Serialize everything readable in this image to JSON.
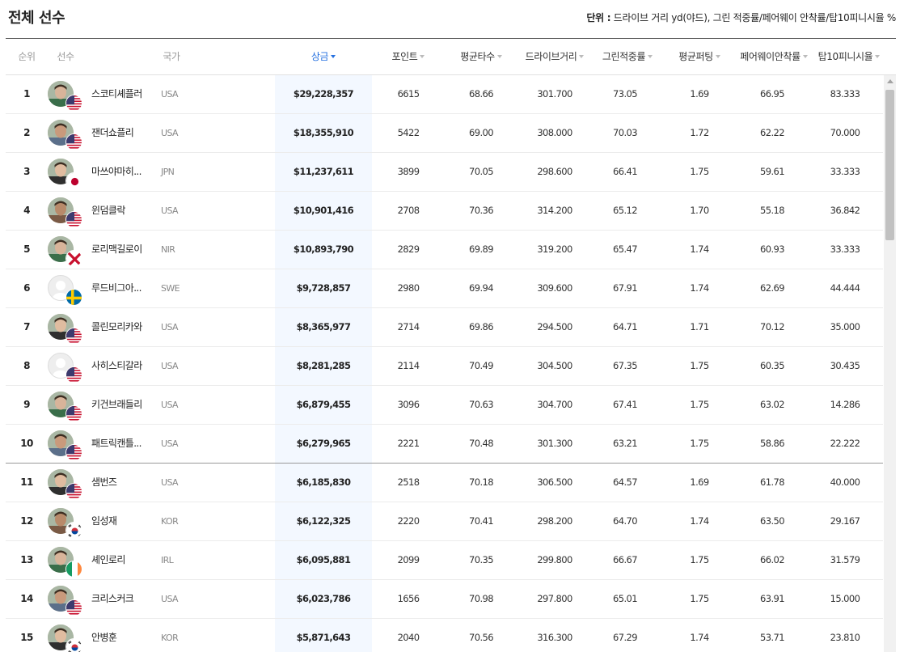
{
  "page": {
    "title": "전체 선수",
    "unit_label": "단위 :",
    "unit_text": "드라이브 거리 yd(야드), 그린 적중률/페어웨이 안착률/탑10피니시율 %"
  },
  "table": {
    "headers": {
      "rank": "순위",
      "player": "선수",
      "nation": "국가",
      "money": "상금",
      "points": "포인트",
      "avg_score": "평균타수",
      "drive": "드라이브거리",
      "green": "그린적중률",
      "putting": "평균퍼팅",
      "fairway": "페어웨이안착률",
      "top10": "탑10피니시율"
    },
    "active_sort": "money",
    "rows": [
      {
        "rank": "1",
        "name": "스코티셰플러",
        "nation": "USA",
        "flag": "usa",
        "avatar": "photo",
        "money": "$29,228,357",
        "points": "6615",
        "avg": "68.66",
        "drive": "301.700",
        "green": "73.05",
        "putt": "1.69",
        "fairway": "66.95",
        "top10": "83.333"
      },
      {
        "rank": "2",
        "name": "잰더쇼플리",
        "nation": "USA",
        "flag": "usa",
        "avatar": "photo",
        "money": "$18,355,910",
        "points": "5422",
        "avg": "69.00",
        "drive": "308.000",
        "green": "70.03",
        "putt": "1.72",
        "fairway": "62.22",
        "top10": "70.000"
      },
      {
        "rank": "3",
        "name": "마쓰야마히...",
        "nation": "JPN",
        "flag": "jpn",
        "avatar": "photo",
        "money": "$11,237,611",
        "points": "3899",
        "avg": "70.05",
        "drive": "298.600",
        "green": "66.41",
        "putt": "1.75",
        "fairway": "59.61",
        "top10": "33.333"
      },
      {
        "rank": "4",
        "name": "윈덤클락",
        "nation": "USA",
        "flag": "usa",
        "avatar": "photo",
        "money": "$10,901,416",
        "points": "2708",
        "avg": "70.36",
        "drive": "314.200",
        "green": "65.12",
        "putt": "1.70",
        "fairway": "55.18",
        "top10": "36.842"
      },
      {
        "rank": "5",
        "name": "로리맥길로이",
        "nation": "NIR",
        "flag": "nir",
        "avatar": "photo",
        "money": "$10,893,790",
        "points": "2829",
        "avg": "69.89",
        "drive": "319.200",
        "green": "65.47",
        "putt": "1.74",
        "fairway": "60.93",
        "top10": "33.333"
      },
      {
        "rank": "6",
        "name": "루드비그아...",
        "nation": "SWE",
        "flag": "swe",
        "avatar": "empty",
        "money": "$9,728,857",
        "points": "2980",
        "avg": "69.94",
        "drive": "309.600",
        "green": "67.91",
        "putt": "1.74",
        "fairway": "62.69",
        "top10": "44.444"
      },
      {
        "rank": "7",
        "name": "콜린모리카와",
        "nation": "USA",
        "flag": "usa",
        "avatar": "photo",
        "money": "$8,365,977",
        "points": "2714",
        "avg": "69.86",
        "drive": "294.500",
        "green": "64.71",
        "putt": "1.71",
        "fairway": "70.12",
        "top10": "35.000"
      },
      {
        "rank": "8",
        "name": "사히스티갈라",
        "nation": "USA",
        "flag": "usa",
        "avatar": "empty",
        "money": "$8,281,285",
        "points": "2114",
        "avg": "70.49",
        "drive": "304.500",
        "green": "67.35",
        "putt": "1.75",
        "fairway": "60.35",
        "top10": "30.435"
      },
      {
        "rank": "9",
        "name": "키건브래들리",
        "nation": "USA",
        "flag": "usa",
        "avatar": "photo",
        "money": "$6,879,455",
        "points": "3096",
        "avg": "70.63",
        "drive": "304.700",
        "green": "67.41",
        "putt": "1.75",
        "fairway": "63.02",
        "top10": "14.286"
      },
      {
        "rank": "10",
        "name": "패트릭캔틀...",
        "nation": "USA",
        "flag": "usa",
        "avatar": "photo",
        "money": "$6,279,965",
        "points": "2221",
        "avg": "70.48",
        "drive": "301.300",
        "green": "63.21",
        "putt": "1.75",
        "fairway": "58.86",
        "top10": "22.222"
      },
      {
        "rank": "11",
        "name": "샘번즈",
        "nation": "USA",
        "flag": "usa",
        "avatar": "photo",
        "money": "$6,185,830",
        "points": "2518",
        "avg": "70.18",
        "drive": "306.500",
        "green": "64.57",
        "putt": "1.69",
        "fairway": "61.78",
        "top10": "40.000"
      },
      {
        "rank": "12",
        "name": "임성재",
        "nation": "KOR",
        "flag": "kor",
        "avatar": "photo",
        "money": "$6,122,325",
        "points": "2220",
        "avg": "70.41",
        "drive": "298.200",
        "green": "64.70",
        "putt": "1.74",
        "fairway": "63.50",
        "top10": "29.167"
      },
      {
        "rank": "13",
        "name": "셰인로리",
        "nation": "IRL",
        "flag": "irl",
        "avatar": "photo",
        "money": "$6,095,881",
        "points": "2099",
        "avg": "70.35",
        "drive": "299.800",
        "green": "66.67",
        "putt": "1.75",
        "fairway": "66.02",
        "top10": "31.579"
      },
      {
        "rank": "14",
        "name": "크리스커크",
        "nation": "USA",
        "flag": "usa",
        "avatar": "photo",
        "money": "$6,023,786",
        "points": "1656",
        "avg": "70.98",
        "drive": "297.800",
        "green": "65.01",
        "putt": "1.75",
        "fairway": "63.91",
        "top10": "15.000"
      },
      {
        "rank": "15",
        "name": "안병훈",
        "nation": "KOR",
        "flag": "kor",
        "avatar": "photo",
        "money": "$5,871,643",
        "points": "2040",
        "avg": "70.56",
        "drive": "316.300",
        "green": "67.29",
        "putt": "1.74",
        "fairway": "53.71",
        "top10": "23.810"
      }
    ]
  },
  "colors": {
    "accent": "#2570e0",
    "sorted_column_bg": "#f3f8ff"
  }
}
